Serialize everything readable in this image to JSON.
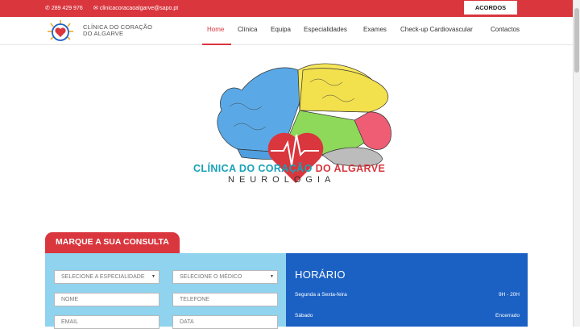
{
  "topbar": {
    "phone": "289 429 976",
    "email": "clinicacoracaoalgarve@sapo.pt",
    "acordos": "ACORDOS",
    "icons": {
      "phone": "phone-icon",
      "email": "envelope-icon"
    }
  },
  "header": {
    "brand_line1": "CLÍNICA DO CORAÇÃO",
    "brand_line2": "DO ALGARVE",
    "nav": [
      "Home",
      "Clínica",
      "Equipa",
      "Especialidades",
      "Exames",
      "Check-up Cardiovascular",
      "Contactos"
    ],
    "active": "Home"
  },
  "hero": {
    "title_part1": "CLÍNICA DO CORAÇÃO ",
    "title_part2": "DO ALGARVE",
    "subtitle": "NEUROLOGIA"
  },
  "consulta": {
    "tab": "MARQUE A SUA CONSULTA",
    "especialidade": "SELECIONE A ESPECIALIDADE",
    "medico": "SELECIONE O MÉDICO",
    "nome": "NOME",
    "telefone": "TELEFONE",
    "email": "EMAIL",
    "data": "DATA"
  },
  "horario": {
    "title": "HORÁRIO",
    "rows": [
      {
        "day": "Segunda a Sexta-feira",
        "hours": "9H - 20H"
      },
      {
        "day": "Sábado",
        "hours": "Encerrado"
      }
    ]
  },
  "colors": {
    "brand_red": "#d9363e",
    "teal": "#17a2b8",
    "form_bg": "#8fd3ee",
    "hours_bg": "#1b61c4"
  }
}
